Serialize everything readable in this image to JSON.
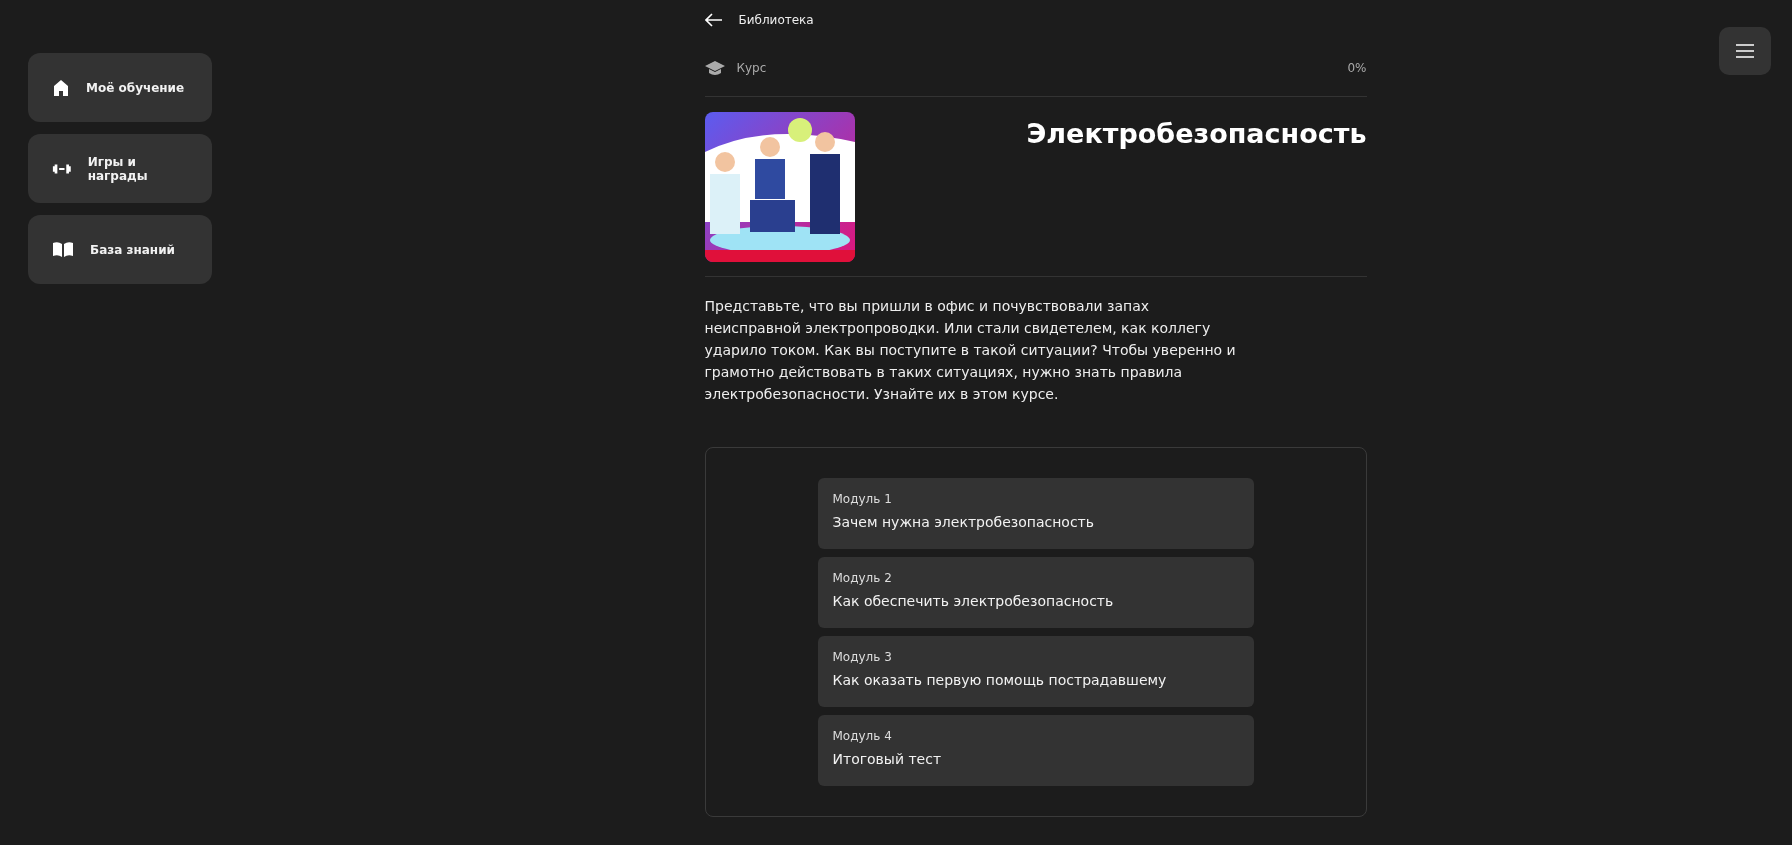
{
  "sidebar": {
    "items": [
      {
        "kind": "home",
        "label": "Моё обучение"
      },
      {
        "kind": "games",
        "label": "Игры и награды"
      },
      {
        "kind": "knowledge",
        "label": "База знаний"
      }
    ]
  },
  "back_link": {
    "label": "Библиотека"
  },
  "course": {
    "type_label": "Курс",
    "progress": "0%",
    "title": "Электробезопасность",
    "description": "Представьте, что вы пришли в офис и почувствовали запах неисправной электропроводки. Или стали свидетелем, как коллегу ударило током. Как вы поступите в такой ситуации? Чтобы уверенно и грамотно действовать в таких ситуациях, нужно знать правила электробезопасности. Узнайте их в этом курсе."
  },
  "modules": [
    {
      "number": "Модуль 1",
      "title": "Зачем нужна электробезопасность"
    },
    {
      "number": "Модуль 2",
      "title": "Как обеспечить электробезопасность"
    },
    {
      "number": "Модуль 3",
      "title": "Как оказать первую помощь пострадавшему"
    },
    {
      "number": "Модуль 4",
      "title": "Итоговый тест"
    }
  ]
}
